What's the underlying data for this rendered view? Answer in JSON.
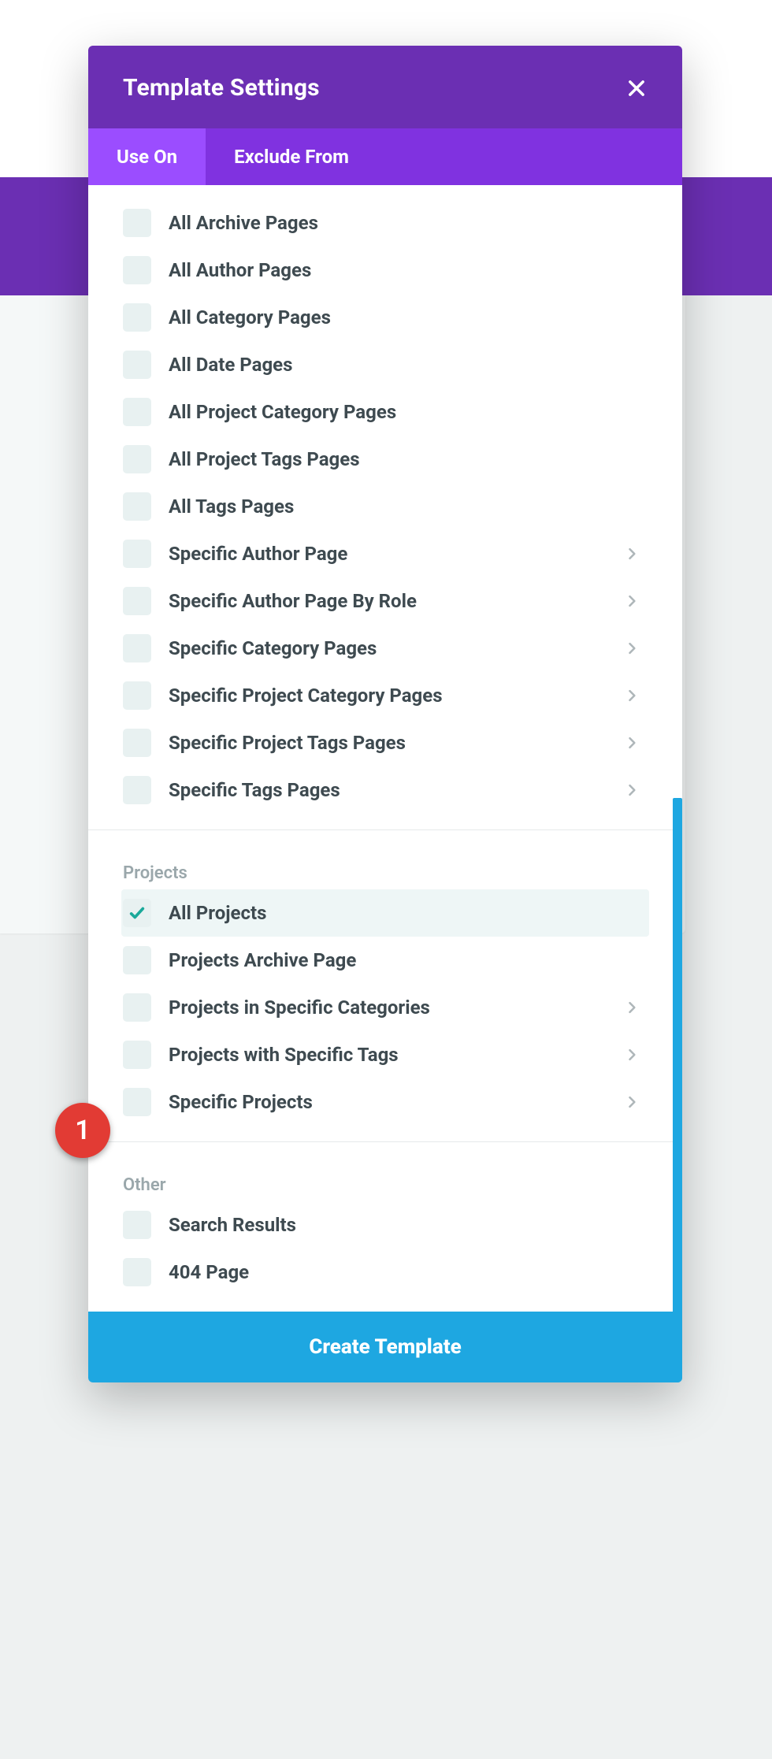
{
  "header": {
    "title": "Template Settings"
  },
  "tabs": {
    "useOn": "Use On",
    "excludeFrom": "Exclude From"
  },
  "sections": {
    "archives": {
      "items": [
        {
          "label": "All Archive Pages",
          "checked": false,
          "chevron": false
        },
        {
          "label": "All Author Pages",
          "checked": false,
          "chevron": false
        },
        {
          "label": "All Category Pages",
          "checked": false,
          "chevron": false
        },
        {
          "label": "All Date Pages",
          "checked": false,
          "chevron": false
        },
        {
          "label": "All Project Category Pages",
          "checked": false,
          "chevron": false
        },
        {
          "label": "All Project Tags Pages",
          "checked": false,
          "chevron": false
        },
        {
          "label": "All Tags Pages",
          "checked": false,
          "chevron": false
        },
        {
          "label": "Specific Author Page",
          "checked": false,
          "chevron": true
        },
        {
          "label": "Specific Author Page By Role",
          "checked": false,
          "chevron": true
        },
        {
          "label": "Specific Category Pages",
          "checked": false,
          "chevron": true
        },
        {
          "label": "Specific Project Category Pages",
          "checked": false,
          "chevron": true
        },
        {
          "label": "Specific Project Tags Pages",
          "checked": false,
          "chevron": true
        },
        {
          "label": "Specific Tags Pages",
          "checked": false,
          "chevron": true
        }
      ]
    },
    "projects": {
      "title": "Projects",
      "items": [
        {
          "label": "All Projects",
          "checked": true,
          "chevron": false,
          "selected": true
        },
        {
          "label": "Projects Archive Page",
          "checked": false,
          "chevron": false
        },
        {
          "label": "Projects in Specific Categories",
          "checked": false,
          "chevron": true
        },
        {
          "label": "Projects with Specific Tags",
          "checked": false,
          "chevron": true
        },
        {
          "label": "Specific Projects",
          "checked": false,
          "chevron": true
        }
      ]
    },
    "other": {
      "title": "Other",
      "items": [
        {
          "label": "Search Results",
          "checked": false,
          "chevron": false
        },
        {
          "label": "404 Page",
          "checked": false,
          "chevron": false
        }
      ]
    }
  },
  "footer": {
    "createTemplate": "Create Template"
  },
  "annotation": {
    "badge1": "1"
  }
}
